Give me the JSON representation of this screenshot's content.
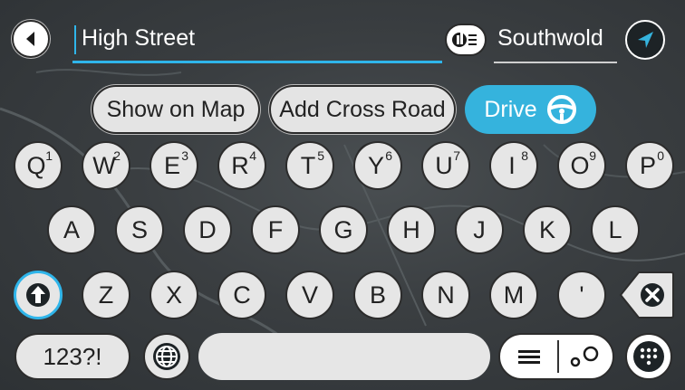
{
  "search": {
    "query": "High Street",
    "area": "Southwold",
    "back_icon": "arrow-left-icon",
    "area_icon": "city-icon",
    "nav_icon": "navigation-arrow-icon"
  },
  "actions": {
    "show_on_map": "Show on Map",
    "add_cross_road": "Add Cross Road",
    "drive": "Drive",
    "drive_icon": "steering-wheel-icon"
  },
  "keyboard": {
    "row1": [
      {
        "label": "Q",
        "sup": "1"
      },
      {
        "label": "W",
        "sup": "2"
      },
      {
        "label": "E",
        "sup": "3"
      },
      {
        "label": "R",
        "sup": "4"
      },
      {
        "label": "T",
        "sup": "5"
      },
      {
        "label": "Y",
        "sup": "6"
      },
      {
        "label": "U",
        "sup": "7"
      },
      {
        "label": "I",
        "sup": "8"
      },
      {
        "label": "O",
        "sup": "9"
      },
      {
        "label": "P",
        "sup": "0"
      }
    ],
    "row2": [
      "A",
      "S",
      "D",
      "F",
      "G",
      "H",
      "J",
      "K",
      "L"
    ],
    "row3": [
      "Z",
      "X",
      "C",
      "V",
      "B",
      "N",
      "M",
      "'"
    ],
    "numbers_key": "123?!",
    "shift_icon": "shift-arrow-icon",
    "backspace_icon": "backspace-icon",
    "globe_icon": "globe-icon",
    "list_view_icon": "list-icon",
    "map_view_icon": "route-icon",
    "keypad_icon": "keypad-icon"
  },
  "colors": {
    "accent": "#2fb5ea",
    "drive_button": "#35b3dd",
    "key_fill": "#e6e6e6",
    "background": "#3a3e41"
  }
}
